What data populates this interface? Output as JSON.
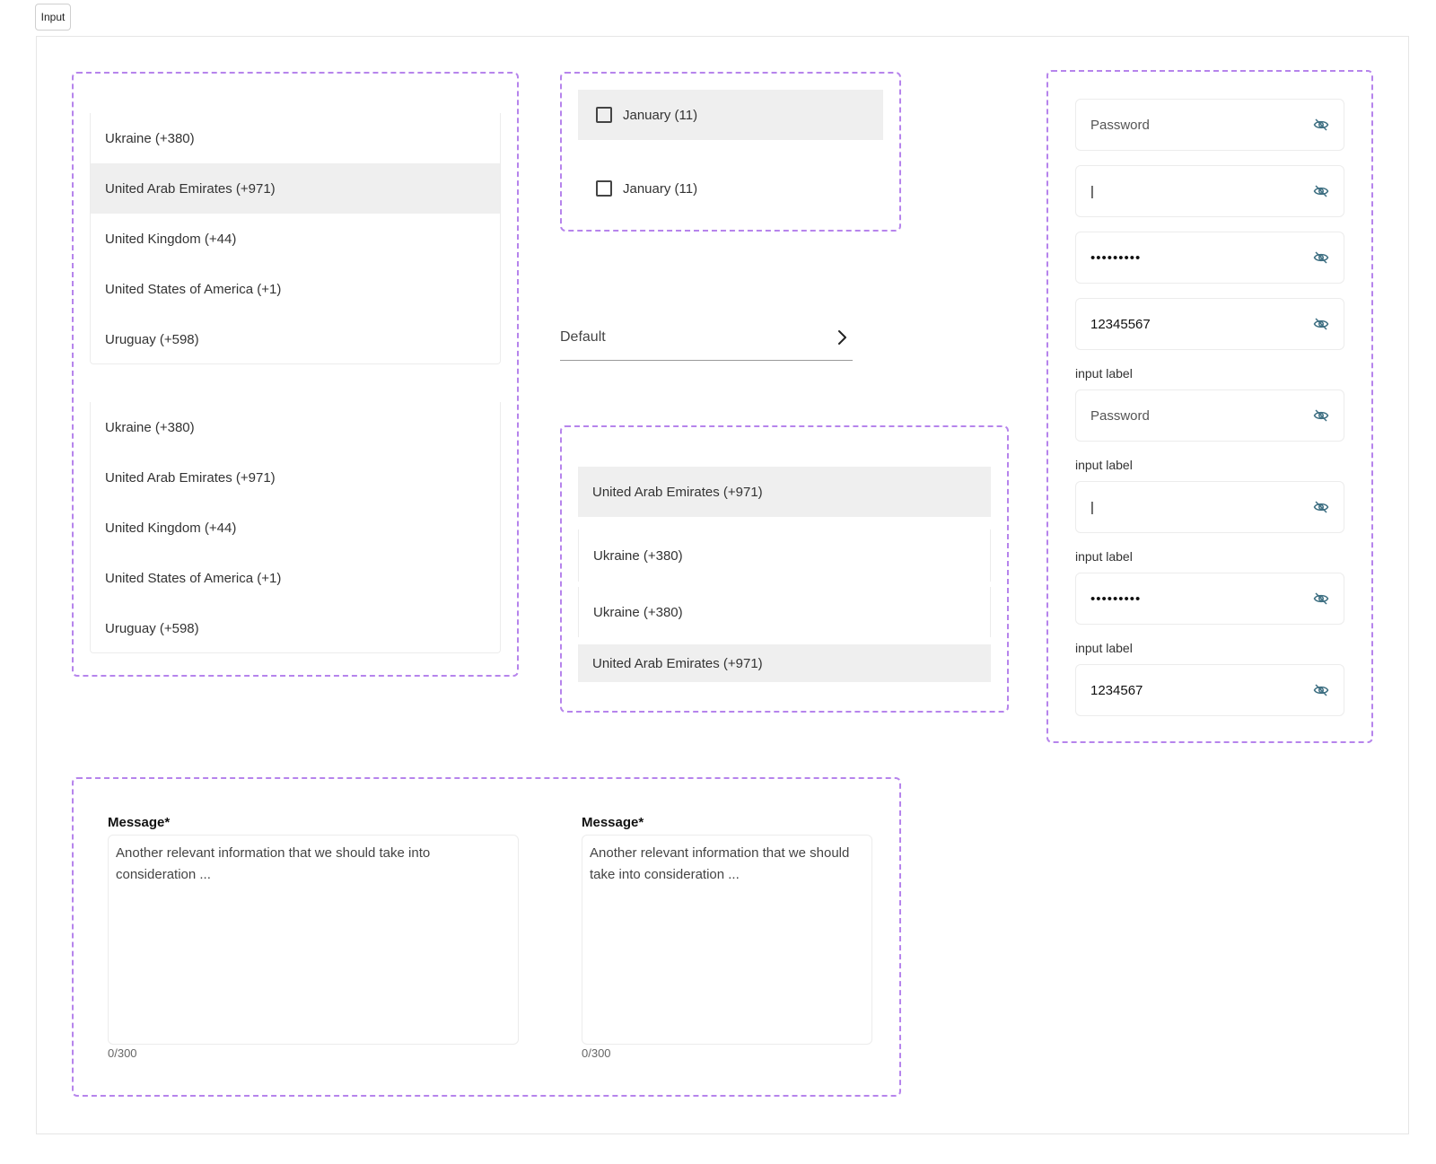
{
  "tag_label": "Input",
  "list_a": [
    "Ukraine (+380)",
    "United Arab Emirates (+971)",
    "United Kingdom (+44)",
    "United States of America (+1)",
    "Uruguay (+598)"
  ],
  "list_b": [
    "Ukraine (+380)",
    "United Arab Emirates (+971)",
    "United Kingdom (+44)",
    "United States of America (+1)",
    "Uruguay (+598)"
  ],
  "checkboxes": [
    "January (11)",
    "January (11)"
  ],
  "select_default": "Default",
  "list_c": [
    "United Arab Emirates (+971)",
    "Ukraine (+380)",
    "Ukraine (+380)",
    "United Arab Emirates (+971)"
  ],
  "passwords": {
    "p1_placeholder": "Password",
    "p2_caret": "|",
    "p3_masked": "•••••••••",
    "p4_value": "12345567",
    "label": "input label",
    "p5_placeholder": "Password",
    "p6_caret": "|",
    "p7_masked": "•••••••••",
    "p8_value": "1234567"
  },
  "messages": {
    "label": "Message*",
    "placeholder_1": "Another relevant information that we should take into consideration ...",
    "placeholder_2": "Another relevant information that we should take into consideration ...",
    "counter": "0/300"
  },
  "colors": {
    "dash": "#b684ec",
    "selected_bg": "#efefef",
    "eye": "#3e6f82"
  }
}
